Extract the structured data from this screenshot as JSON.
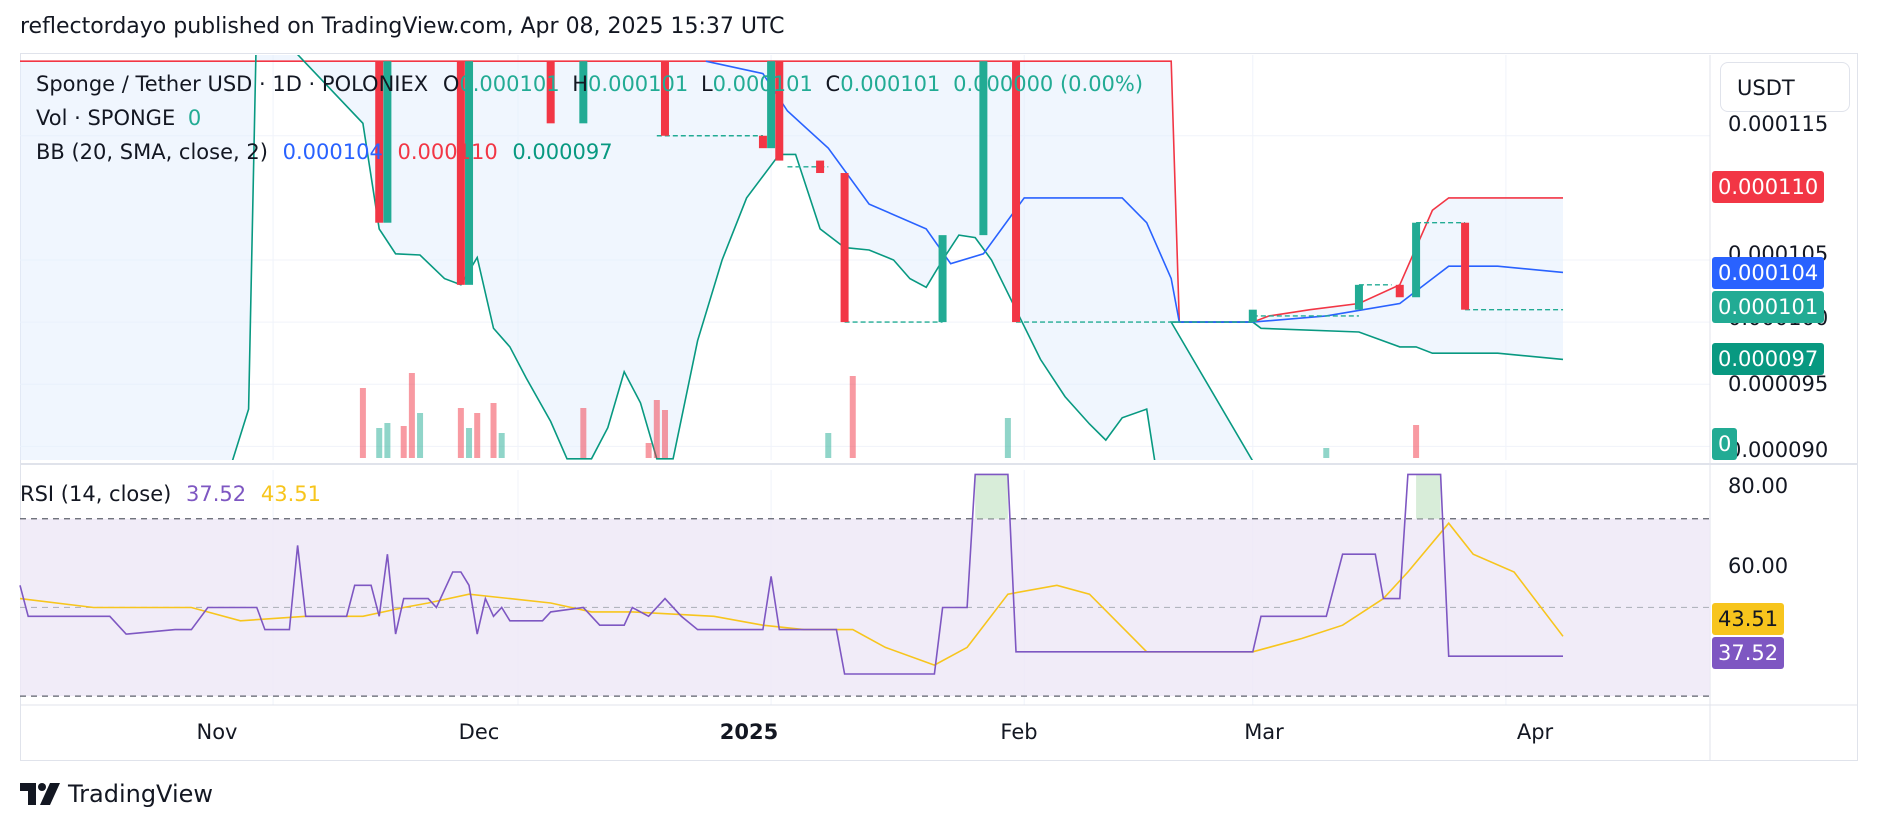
{
  "caption": "reflectordayo published on TradingView.com, Apr 08, 2025 15:37 UTC",
  "legend": {
    "symbol": "Sponge / Tether USD · 1D · POLONIEX",
    "o_label": "O",
    "o_val": "0.000101",
    "h_label": "H",
    "h_val": "0.000101",
    "l_label": "L",
    "l_val": "0.000101",
    "c_label": "C",
    "c_val": "0.000101",
    "change": "0.000000 (0.00%)",
    "vol_label": "Vol · SPONGE",
    "vol_val": "0",
    "bb_label": "BB (20, SMA, close, 2)",
    "bb_basis": "0.000104",
    "bb_upper": "0.000110",
    "bb_lower": "0.000097"
  },
  "rsi_legend": {
    "label": "RSI (14, close)",
    "rsi": "37.52",
    "ma": "43.51"
  },
  "currency_button": "USDT",
  "price_pills": {
    "upper": "0.000110",
    "basis": "0.000104",
    "close": "0.000101",
    "lower": "0.000097",
    "volume": "0"
  },
  "rsi_pills": {
    "ma": "43.51",
    "rsi": "37.52"
  },
  "price_axis_ticks": [
    "0.000115",
    "0.000105",
    "0.000100",
    "0.000095",
    "0.000090"
  ],
  "rsi_axis_ticks": [
    "80.00",
    "60.00"
  ],
  "x_axis": [
    {
      "label": "Nov",
      "bold": false
    },
    {
      "label": "Dec",
      "bold": false
    },
    {
      "label": "2025",
      "bold": true
    },
    {
      "label": "Feb",
      "bold": false
    },
    {
      "label": "Mar",
      "bold": false
    },
    {
      "label": "Apr",
      "bold": false
    }
  ],
  "footer": "TradingView",
  "colors": {
    "up": "#22ab94",
    "down": "#f23645",
    "bb_basis": "#2962ff",
    "bb_upper": "#f23645",
    "bb_lower": "#089981",
    "bb_fill": "#e3effd",
    "rsi": "#7e57c2",
    "rsi_ma": "#f7c51d",
    "rsi_band": "#ede7f6"
  },
  "chart_data": {
    "type": "candlestick",
    "title": "Sponge / Tether USD · 1D · POLONIEX",
    "period": "Oct 2024 – Apr 2025",
    "price_axis": {
      "ticks": [
        0.000115,
        0.000105,
        0.0001,
        9.5e-05,
        9e-05
      ],
      "ylim": [
        8.89e-05,
        0.0001215
      ]
    },
    "candles": [
      {
        "date": "2024-11-14",
        "open": 0.000121,
        "close": 0.000108,
        "dir": "down"
      },
      {
        "date": "2024-11-15",
        "open": 0.000108,
        "close": 0.000121,
        "dir": "up"
      },
      {
        "date": "2024-11-24",
        "open": 0.000121,
        "close": 0.000103,
        "dir": "down"
      },
      {
        "date": "2024-11-25",
        "open": 0.000103,
        "close": 0.000121,
        "dir": "up"
      },
      {
        "date": "2024-12-05",
        "open": 0.000121,
        "close": 0.000116,
        "dir": "down"
      },
      {
        "date": "2024-12-09",
        "open": 0.000116,
        "close": 0.000121,
        "dir": "up"
      },
      {
        "date": "2024-12-19",
        "open": 0.000121,
        "close": 0.000115,
        "dir": "down"
      },
      {
        "date": "2024-12-31",
        "open": 0.000115,
        "close": 0.000114,
        "dir": "down"
      },
      {
        "date": "2025-01-01",
        "open": 0.000114,
        "close": 0.000121,
        "dir": "up"
      },
      {
        "date": "2025-01-02",
        "open": 0.000121,
        "close": 0.000113,
        "dir": "down"
      },
      {
        "date": "2025-01-07",
        "open": 0.000113,
        "close": 0.000112,
        "dir": "down"
      },
      {
        "date": "2025-01-10",
        "open": 0.000112,
        "close": 0.0001,
        "dir": "down"
      },
      {
        "date": "2025-01-22",
        "open": 0.0001,
        "close": 0.000107,
        "dir": "up"
      },
      {
        "date": "2025-01-27",
        "open": 0.000107,
        "close": 0.000121,
        "dir": "up"
      },
      {
        "date": "2025-01-31",
        "open": 0.000121,
        "close": 0.0001,
        "dir": "down"
      },
      {
        "date": "2025-03-01",
        "open": 0.0001,
        "close": 0.000101,
        "dir": "up"
      },
      {
        "date": "2025-03-14",
        "open": 0.000101,
        "close": 0.000103,
        "dir": "up"
      },
      {
        "date": "2025-03-19",
        "open": 0.000103,
        "close": 0.000102,
        "dir": "down"
      },
      {
        "date": "2025-03-21",
        "open": 0.000102,
        "close": 0.000108,
        "dir": "up"
      },
      {
        "date": "2025-03-27",
        "open": 0.000108,
        "close": 0.000101,
        "dir": "down"
      }
    ],
    "bollinger": {
      "period": 20,
      "std": 2,
      "basis_last": 0.000104,
      "upper_last": 0.00011,
      "lower_last": 9.7e-05
    },
    "rsi": {
      "period": 14,
      "last": 37.52,
      "ma_last": 43.51,
      "ylim": [
        28,
        81
      ],
      "levels": [
        70,
        50,
        30
      ]
    },
    "x_labels": [
      "Nov",
      "Dec",
      "2025",
      "Feb",
      "Mar",
      "Apr"
    ]
  }
}
